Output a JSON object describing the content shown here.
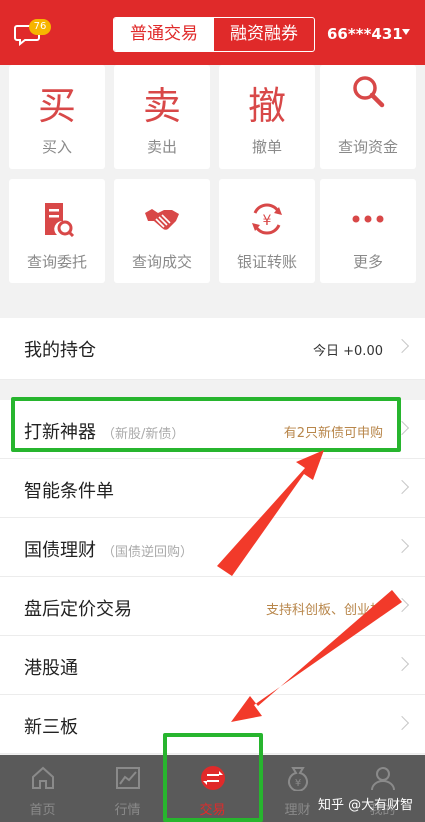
{
  "header": {
    "badge_count": "76",
    "tabs": [
      "普通交易",
      "融资融券"
    ],
    "active_tab": 0,
    "account": "66***431"
  },
  "actions": [
    {
      "glyph": "买",
      "label": "买入"
    },
    {
      "glyph": "卖",
      "label": "卖出"
    },
    {
      "glyph": "撤",
      "label": "撤单"
    },
    {
      "icon": "search-icon",
      "label": "查询资金"
    },
    {
      "icon": "document-search-icon",
      "label": "查询委托"
    },
    {
      "icon": "handshake-icon",
      "label": "查询成交"
    },
    {
      "icon": "yuan-transfer-icon",
      "label": "银证转账"
    },
    {
      "icon": "more-icon",
      "label": "更多"
    }
  ],
  "list": [
    {
      "title": "我的持仓",
      "sub": "",
      "right": "今日 +0.00",
      "right_style": "dark"
    },
    {
      "title": "打新神器",
      "sub": "（新股/新债）",
      "right": "有2只新债可申购",
      "right_style": "gold"
    },
    {
      "title": "智能条件单",
      "sub": "",
      "right": "",
      "right_style": "gold"
    },
    {
      "title": "国债理财",
      "sub": "（国债逆回购）",
      "right": "",
      "right_style": "gold"
    },
    {
      "title": "盘后定价交易",
      "sub": "",
      "right": "支持科创板、创业板",
      "right_style": "gold"
    },
    {
      "title": "港股通",
      "sub": "",
      "right": "",
      "right_style": "gold"
    },
    {
      "title": "新三板",
      "sub": "",
      "right": "",
      "right_style": "gold"
    }
  ],
  "nav": [
    {
      "icon": "home-icon",
      "label": "首页"
    },
    {
      "icon": "chart-icon",
      "label": "行情"
    },
    {
      "icon": "trade-icon",
      "label": "交易"
    },
    {
      "icon": "wealth-icon",
      "label": "理财"
    },
    {
      "icon": "user-icon",
      "label": "我的"
    }
  ],
  "active_nav": 2,
  "watermark": "知乎 @大有财智",
  "colors": {
    "brand_red": "#e02a2a",
    "highlight_green": "#27b52e",
    "gold_text": "#b8864a"
  }
}
